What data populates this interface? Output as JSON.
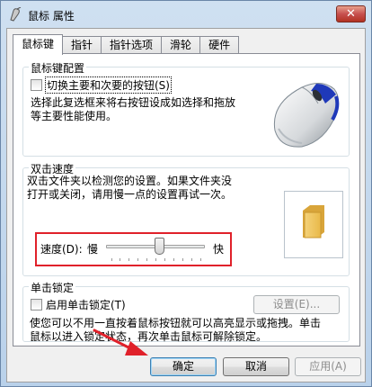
{
  "window": {
    "title": "鼠标 属性",
    "close_symbol": "✕"
  },
  "tabs": [
    {
      "label": "鼠标键",
      "active": true
    },
    {
      "label": "指针",
      "active": false
    },
    {
      "label": "指针选项",
      "active": false
    },
    {
      "label": "滑轮",
      "active": false
    },
    {
      "label": "硬件",
      "active": false
    }
  ],
  "button_config": {
    "title": "鼠标键配置",
    "checkbox_label": "切换主要和次要的按钮(S)",
    "checked": false,
    "description_line1": "选择此复选框来将右按钮设成如选择和拖放",
    "description_line2": "等主要性能使用。"
  },
  "double_click": {
    "title": "双击速度",
    "description_line1": "双击文件夹以检测您的设置。如果文件夹没",
    "description_line2": "打开或关闭，请用慢一点的设置再试一次。",
    "speed_label": "速度(D):",
    "slow_label": "慢",
    "fast_label": "快",
    "speed_fraction": 0.55
  },
  "click_lock": {
    "title": "单击锁定",
    "checkbox_label": "启用单击锁定(T)",
    "checked": false,
    "settings_button": "设置(E)...",
    "description_line1": "使您可以不用一直按着鼠标按钮就可以高亮显示或拖拽。单击",
    "description_line2": "鼠标以进入锁定状态，再次单击鼠标可解除锁定。"
  },
  "footer": {
    "ok": "确定",
    "cancel": "取消",
    "apply": "应用(A)"
  },
  "colors": {
    "annotation_red": "#e0212a",
    "close_red": "#c75050"
  }
}
